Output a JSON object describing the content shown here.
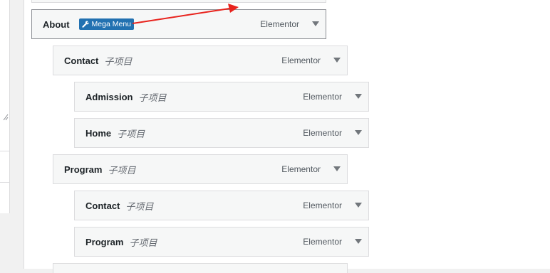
{
  "menu_items": [
    {
      "title": "About",
      "badge": "Mega Menu",
      "type_label": "Elementor"
    },
    {
      "title": "Contact",
      "sub_label": "子项目",
      "type_label": "Elementor"
    },
    {
      "title": "Admission",
      "sub_label": "子项目",
      "type_label": "Elementor"
    },
    {
      "title": "Home",
      "sub_label": "子项目",
      "type_label": "Elementor"
    },
    {
      "title": "Program",
      "sub_label": "子项目",
      "type_label": "Elementor"
    },
    {
      "title": "Contact",
      "sub_label": "子项目",
      "type_label": "Elementor"
    },
    {
      "title": "Program",
      "sub_label": "子项目",
      "type_label": "Elementor"
    }
  ],
  "icons": {
    "badge": "wrench-icon",
    "toggle": "triangle-down-icon",
    "annotation": "red-arrow"
  },
  "colors": {
    "badge_bg": "#2271b1",
    "arrow": "#e8231d",
    "item_bg": "#f6f7f7",
    "item_border": "#dcdcde"
  }
}
